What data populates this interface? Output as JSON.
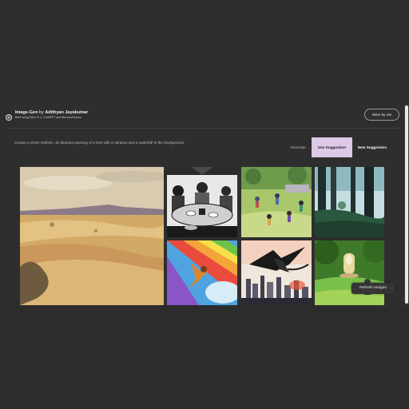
{
  "header": {
    "app_name": "Image-Gen",
    "by_text": " by ",
    "author": "Adithyan Jayakumar",
    "subtitle": "Built using DALL-E 2, ChatGPT and Microsoft Azure",
    "more_button": "More by me"
  },
  "prompt": {
    "text": "Create a photo-realistic, 4k abstract painting of a tree with a rainbow and a waterfall in the background."
  },
  "tabs": {
    "generate": "Generate",
    "use_suggestion": "Use Suggestion",
    "new_suggestion": "New Suggestion",
    "active": "use_suggestion"
  },
  "gallery": {
    "images": [
      "desert-dunes",
      "family-dinner-sketch",
      "kids-playing-park",
      "forest-silhouette",
      "rainbow-sky-diver",
      "dragon-over-city",
      "garden-fountain"
    ]
  },
  "refresh_button": "Refresh Images",
  "colors": {
    "page_bg": "#2c2c2c",
    "accent_tab": "#ddc8e6"
  }
}
